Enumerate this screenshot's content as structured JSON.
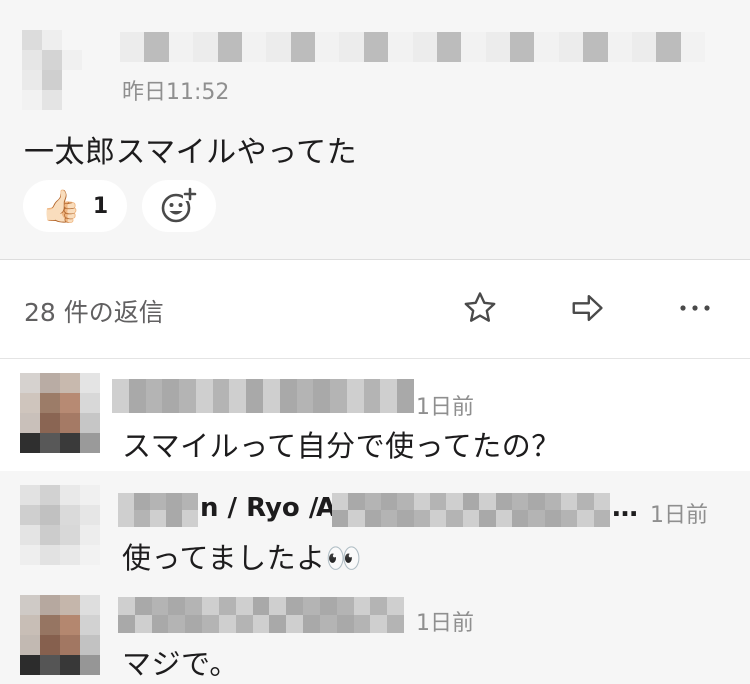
{
  "parent_message": {
    "timestamp": "昨日11:52",
    "text": "一太郎スマイルやってた",
    "reactions": [
      {
        "emoji": "👍🏻",
        "icon": "thumbs-up-icon",
        "count": "1"
      }
    ],
    "add_reaction_icon": "add-reaction-icon"
  },
  "thread": {
    "reply_count_label": "28 件の返信",
    "actions": [
      "star-icon",
      "share-icon",
      "more-icon"
    ]
  },
  "replies": [
    {
      "time": "1日前",
      "text": "スマイルって自分で使ってたの？"
    },
    {
      "name_fragment_1": "n / Ryo /",
      "name_fragment_2": "A",
      "name_ellipsis": "…",
      "time": "1日前",
      "text": "使ってましたよ👀"
    },
    {
      "time": "1日前",
      "text": "マジで。"
    }
  ],
  "colors": {
    "message_bg": "#f6f6f6",
    "text": "#1d1c1d",
    "timestamp": "#8f8f8f",
    "secondary": "#616061",
    "icon": "#4a4a4a"
  }
}
